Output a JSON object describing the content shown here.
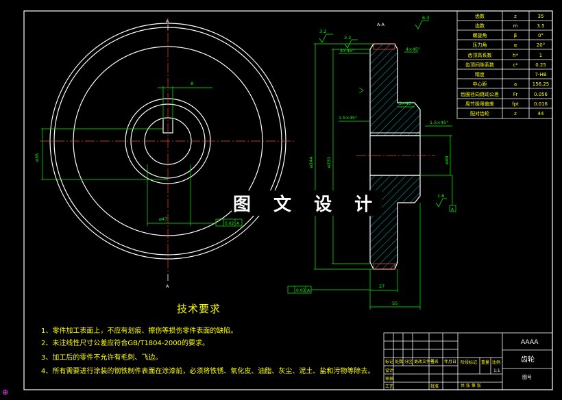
{
  "colors": {
    "background": "#000000",
    "outline": "#ffffff",
    "dimension": "#00ff00",
    "text": "#ffff00",
    "hatch": "#00e5e5",
    "tooth_mark": "#ff4040"
  },
  "watermark": "图 文 设 计",
  "section_label": "A-A",
  "view_label_top": "A",
  "view_label_bottom": "A",
  "roughness_corner": "6.3",
  "left_view": {
    "dim_keyway": "8",
    "dim_hub_dia": "ø36",
    "dim_bore": "ø47",
    "datum": "A",
    "tolerance_tag": "0.02"
  },
  "section_view": {
    "chamfer_top_left": "4×45°",
    "chamfer_top_right": "4×45°",
    "chamfer_hub": "3×45°",
    "chamfer_hub_right": "1.5×45°",
    "chamfer_left_lower": "1.5×45°",
    "dia_tip": "ø244",
    "dia_root": "ø231",
    "dia_bore": "ø40",
    "width_rim": "27",
    "width_total": "55",
    "roughness_top": "3.2",
    "roughness_side": "3.2",
    "roughness_bottom": "1.6",
    "datum": "A",
    "tolerance_tag": "0.03"
  },
  "param_table": {
    "rows": [
      {
        "name": "齿数",
        "symbol": "z",
        "value": "35"
      },
      {
        "name": "齿数",
        "symbol": "m",
        "value": "3.5"
      },
      {
        "name": "螺旋角",
        "symbol": "β",
        "value": "0°"
      },
      {
        "name": "压力角",
        "symbol": "α",
        "value": "20°"
      },
      {
        "name": "齿顶高系数",
        "symbol": "h*",
        "value": "1"
      },
      {
        "name": "齿顶间隙系数",
        "symbol": "c*",
        "value": "0.25"
      },
      {
        "name": "精度",
        "symbol": "",
        "value": "7-HB"
      },
      {
        "name": "中心距",
        "symbol": "a",
        "value": "156.25"
      },
      {
        "name": "齿圈径向跳动公差",
        "symbol": "Fr",
        "value": "0.056"
      },
      {
        "name": "周节极限偏差",
        "symbol": "fpt",
        "value": "0.016"
      },
      {
        "name": "配对齿轮",
        "symbol": "z",
        "value": "44"
      }
    ]
  },
  "tech_req": {
    "title": "技术要求",
    "lines": [
      "1、零件加工表面上，不应有划痕、擦伤等损伤零件表面的缺陷。",
      "2、未注线性尺寸公差应符合GB/T1804-2000的要求。",
      "3、加工后的零件不允许有毛刺、飞边。",
      "4、所有需要进行涂装的钢铁制件表面在涂漆前，必须将铁锈、氧化皮、油脂、灰尘、泥土、盐和污物等除去。"
    ]
  },
  "title_block": {
    "company": "AAAA",
    "part_name": "齿轮",
    "drawing_no": "图号",
    "scale": "1:1",
    "col_labels": [
      "标记",
      "处数",
      "分区",
      "更改文件号",
      "签名",
      "年月日"
    ],
    "row_labels": [
      "设计",
      "审核",
      "工艺",
      "批准"
    ],
    "stage_label": "阶段标记",
    "weight_label": "重量",
    "ratio_label": "比例",
    "footer": "共 张 第 张"
  },
  "corner_mark": "⊕"
}
